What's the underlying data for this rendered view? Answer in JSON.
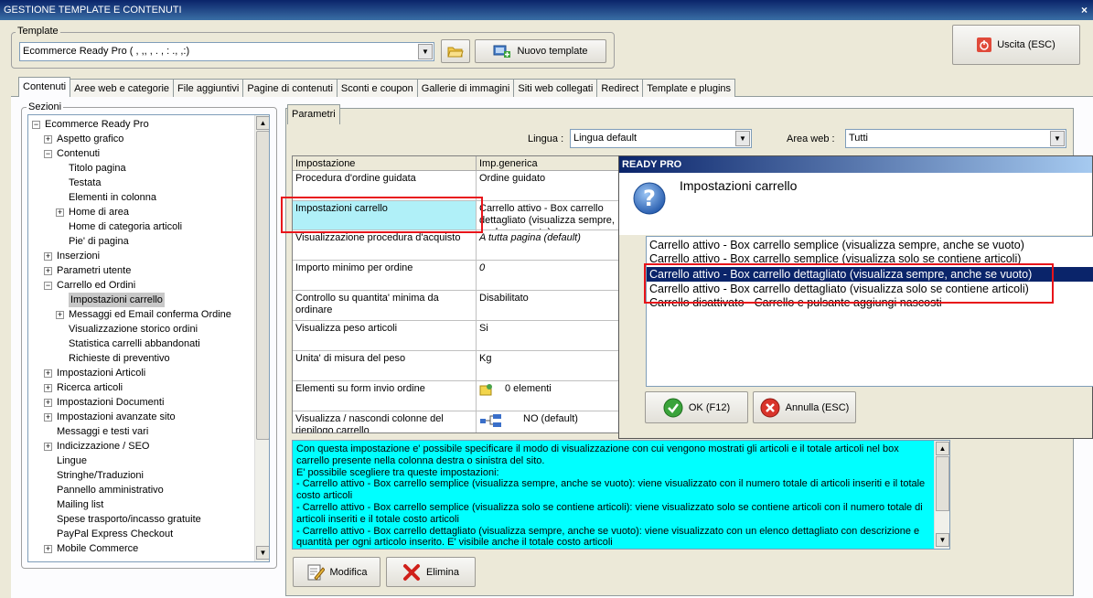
{
  "window": {
    "title": "GESTIONE TEMPLATE E CONTENUTI",
    "close": "×"
  },
  "template": {
    "group_label": "Template",
    "selected": "Ecommerce Ready Pro ( ,  ,,  ,  .  , :  .,  ,:)",
    "new_button": "Nuovo template"
  },
  "exit_button": "Uscita (ESC)",
  "tabs": [
    "Contenuti",
    "Aree web e categorie",
    "File aggiuntivi",
    "Pagine di contenuti",
    "Sconti e coupon",
    "Gallerie di immagini",
    "Siti web collegati",
    "Redirect",
    "Template e plugins"
  ],
  "sections": {
    "group_label": "Sezioni",
    "tree": [
      {
        "label": "Ecommerce Ready Pro",
        "level": 0,
        "toggle": "−"
      },
      {
        "label": "Aspetto grafico",
        "level": 1,
        "toggle": "+"
      },
      {
        "label": "Contenuti",
        "level": 1,
        "toggle": "−"
      },
      {
        "label": "Titolo pagina",
        "level": 2,
        "toggle": ""
      },
      {
        "label": "Testata",
        "level": 2,
        "toggle": ""
      },
      {
        "label": "Elementi in colonna",
        "level": 2,
        "toggle": ""
      },
      {
        "label": "Home di area",
        "level": 2,
        "toggle": "+"
      },
      {
        "label": "Home di categoria articoli",
        "level": 2,
        "toggle": ""
      },
      {
        "label": "Pie' di pagina",
        "level": 2,
        "toggle": ""
      },
      {
        "label": "Inserzioni",
        "level": 1,
        "toggle": "+"
      },
      {
        "label": "Parametri utente",
        "level": 1,
        "toggle": "+"
      },
      {
        "label": "Carrello ed Ordini",
        "level": 1,
        "toggle": "−"
      },
      {
        "label": "Impostazioni carrello",
        "level": 2,
        "toggle": "",
        "selected": true
      },
      {
        "label": "Messaggi ed Email conferma Ordine",
        "level": 2,
        "toggle": "+"
      },
      {
        "label": "Visualizzazione storico ordini",
        "level": 2,
        "toggle": ""
      },
      {
        "label": "Statistica carrelli abbandonati",
        "level": 2,
        "toggle": ""
      },
      {
        "label": "Richieste di preventivo",
        "level": 2,
        "toggle": ""
      },
      {
        "label": "Impostazioni Articoli",
        "level": 1,
        "toggle": "+"
      },
      {
        "label": "Ricerca articoli",
        "level": 1,
        "toggle": "+"
      },
      {
        "label": "Impostazioni Documenti",
        "level": 1,
        "toggle": "+"
      },
      {
        "label": "Impostazioni avanzate sito",
        "level": 1,
        "toggle": "+"
      },
      {
        "label": "Messaggi e testi vari",
        "level": 1,
        "toggle": ""
      },
      {
        "label": "Indicizzazione / SEO",
        "level": 1,
        "toggle": "+"
      },
      {
        "label": "Lingue",
        "level": 1,
        "toggle": ""
      },
      {
        "label": "Stringhe/Traduzioni",
        "level": 1,
        "toggle": ""
      },
      {
        "label": "Pannello amministrativo",
        "level": 1,
        "toggle": ""
      },
      {
        "label": "Mailing list",
        "level": 1,
        "toggle": ""
      },
      {
        "label": "Spese trasporto/incasso gratuite",
        "level": 1,
        "toggle": ""
      },
      {
        "label": "PayPal Express Checkout",
        "level": 1,
        "toggle": ""
      },
      {
        "label": "Mobile Commerce",
        "level": 1,
        "toggle": "+"
      }
    ]
  },
  "params": {
    "tab": "Parametri",
    "language_label": "Lingua :",
    "language_value": "Lingua default",
    "area_label": "Area web :",
    "area_value": "Tutti",
    "col_setting": "Impostazione",
    "col_value": "Imp.generica",
    "rows": [
      {
        "name": "Procedura d'ordine guidata",
        "value": "Ordine guidato"
      },
      {
        "name": "Impostazioni carrello",
        "value": "Carrello attivo - Box carrello dettagliato (visualizza sempre, anche se vuoto)"
      },
      {
        "name": "Visualizzazione procedura d'acquisto",
        "value": "A tutta pagina (default)"
      },
      {
        "name": "Importo minimo per ordine",
        "value": "0"
      },
      {
        "name": "Controllo su quantita' minima da ordinare",
        "value": "Disabilitato"
      },
      {
        "name": "Visualizza peso articoli",
        "value": "Si"
      },
      {
        "name": "Unita' di misura del peso",
        "value": "Kg"
      },
      {
        "name": "Elementi su form invio ordine",
        "value": "0 elementi"
      },
      {
        "name": "Visualizza / nascondi colonne del riepilogo carrello",
        "value": "NO (default)"
      }
    ],
    "description": [
      "Con questa impostazione e' possibile specificare il modo di visualizzazione con cui vengono mostrati gli articoli e il totale articoli nel box carrello presente nella colonna destra o sinistra del sito.",
      "E' possibile scegliere tra queste impostazioni:",
      "- Carrello attivo - Box carrello semplice (visualizza sempre, anche se vuoto): viene visualizzato con il numero totale di articoli inseriti e il totale costo articoli",
      "- Carrello attivo - Box carrello semplice (visualizza solo se contiene articoli): viene visualizzato solo se contiene articoli con il numero totale di articoli inseriti e il totale costo articoli",
      "- Carrello attivo - Box carrello dettagliato (visualizza sempre, anche se vuoto): viene visualizzato con un elenco dettagliato con descrizione e quantità per ogni articolo inserito. E' visibile anche il totale costo articoli"
    ],
    "modify_button": "Modifica",
    "delete_button": "Elimina"
  },
  "dialog": {
    "title": "READY PRO",
    "heading": "Impostazioni carrello",
    "options": [
      "Carrello attivo - Box carrello semplice (visualizza sempre, anche se vuoto)",
      "Carrello attivo - Box carrello semplice (visualizza solo se contiene articoli)",
      "Carrello attivo - Box carrello dettagliato (visualizza sempre, anche se vuoto)",
      "Carrello attivo - Box carrello dettagliato (visualizza solo se contiene articoli)",
      "Carrello disattivato - Carrello e pulsante aggiungi nascosti"
    ],
    "selected_index": 2,
    "ok_button": "OK (F12)",
    "cancel_button": "Annulla (ESC)"
  },
  "colors": {
    "highlight_red": "#e8141a",
    "selection": "#0a246a",
    "description_bg": "#00ffff",
    "selected_cell_bg": "#b0f0f8"
  }
}
